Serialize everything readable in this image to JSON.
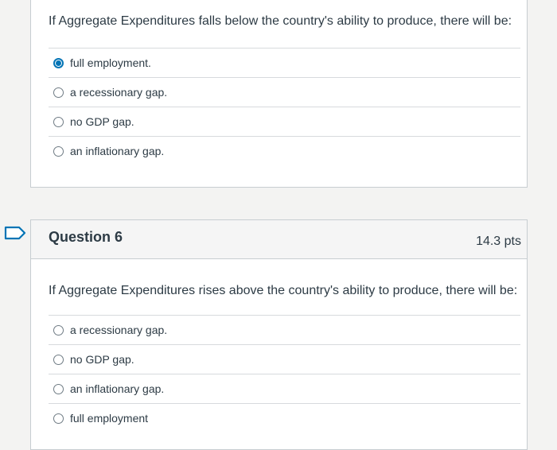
{
  "question5": {
    "prompt": "If Aggregate Expenditures falls below the country's ability to produce, there will be:",
    "answers": [
      {
        "label": "full employment.",
        "selected": true
      },
      {
        "label": "a recessionary gap.",
        "selected": false
      },
      {
        "label": "no GDP gap.",
        "selected": false
      },
      {
        "label": "an inflationary gap.",
        "selected": false
      }
    ]
  },
  "question6": {
    "title": "Question 6",
    "points": "14.3 pts",
    "prompt": "If Aggregate Expenditures rises above the country's ability to produce, there will be:",
    "answers": [
      {
        "label": "a recessionary gap.",
        "selected": false
      },
      {
        "label": "no GDP gap.",
        "selected": false
      },
      {
        "label": "an inflationary gap.",
        "selected": false
      },
      {
        "label": "full employment",
        "selected": false
      }
    ]
  },
  "icons": {
    "flag": "bookmark-flag-icon",
    "radio": "radio-button-icon"
  },
  "colors": {
    "accent": "#0374b5",
    "text": "#2d3b45",
    "border": "#c7cdd1",
    "header_bg": "#f5f5f5"
  }
}
